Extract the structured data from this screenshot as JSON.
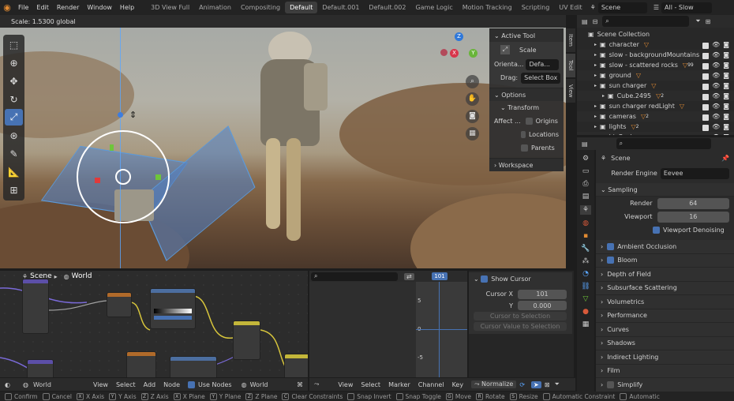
{
  "menu": [
    "File",
    "Edit",
    "Render",
    "Window",
    "Help"
  ],
  "workspaces": [
    "3D View Full",
    "Animation",
    "Compositing",
    "Default",
    "Default.001",
    "Default.002",
    "Game Logic",
    "Motion Tracking",
    "Scripting",
    "UV Edit"
  ],
  "active_workspace": "Default",
  "scene_label": "Scene",
  "view_layer": "All - Slow",
  "viewport": {
    "scale_readout": "Scale: 1.5300 global",
    "side_tabs": [
      "Item",
      "Tool",
      "View"
    ],
    "active_tool": {
      "header": "Active Tool",
      "tool_name": "Scale",
      "orientation_label": "Orienta...",
      "orientation_value": "Defa...",
      "drag_label": "Drag:",
      "drag_value": "Select Box"
    },
    "options": {
      "header": "Options",
      "transform_header": "Transform",
      "affect_label": "Affect ...",
      "affect_items": [
        "Origins",
        "Locations",
        "Parents"
      ]
    },
    "workspace_header": "Workspace",
    "gizmo_axes": [
      "Z",
      "Y",
      "X"
    ]
  },
  "outliner": {
    "search_placeholder": "",
    "root": "Scene Collection",
    "items": [
      {
        "name": "character",
        "badge": ""
      },
      {
        "name": "slow - backgroundMountains",
        "badge": ""
      },
      {
        "name": "slow - scattered rocks",
        "badge": "99"
      },
      {
        "name": "ground",
        "badge": ""
      },
      {
        "name": "sun charger",
        "badge": ""
      },
      {
        "name": "Cube.2495",
        "badge": "2"
      },
      {
        "name": "sun charger redLight",
        "badge": ""
      },
      {
        "name": "cameras",
        "badge": "2"
      },
      {
        "name": "lights",
        "badge": "2"
      },
      {
        "name": "bigRocks",
        "badge": ""
      }
    ]
  },
  "properties": {
    "header": "Scene",
    "render_engine_label": "Render Engine",
    "render_engine_value": "Eevee",
    "sampling_label": "Sampling",
    "render_label": "Render",
    "render_value": "64",
    "viewport_label": "Viewport",
    "viewport_value": "16",
    "denoise_label": "Viewport Denoising",
    "panels": [
      "Ambient Occlusion",
      "Bloom",
      "Depth of Field",
      "Subsurface Scattering",
      "Volumetrics",
      "Performance",
      "Curves",
      "Shadows",
      "Indirect Lighting",
      "Film",
      "Simplify"
    ]
  },
  "node_editor": {
    "header_scene": "Scene",
    "header_world": "World",
    "footer": {
      "world": "World",
      "use_nodes": "Use Nodes",
      "world2": "World"
    }
  },
  "timeline": {
    "current_frame": "101",
    "yticks": [
      "5",
      "0",
      "-5"
    ],
    "menus": [
      "View",
      "Select",
      "Marker",
      "Channel",
      "Key"
    ],
    "normalize": "Normalize"
  },
  "cursor_panel": {
    "show_cursor": "Show Cursor",
    "cursor_x_label": "Cursor X",
    "cursor_x": "101",
    "y_label": "Y",
    "y_value": "0.000",
    "btn1": "Cursor to Selection",
    "btn2": "Cursor Value to Selection"
  },
  "status": [
    {
      "key": "",
      "label": "Confirm"
    },
    {
      "key": "",
      "label": "Cancel"
    },
    {
      "key": "X",
      "label": "X Axis"
    },
    {
      "key": "Y",
      "label": "Y Axis"
    },
    {
      "key": "Z",
      "label": "Z Axis"
    },
    {
      "key": "X",
      "label": "X Plane"
    },
    {
      "key": "Y",
      "label": "Y Plane"
    },
    {
      "key": "Z",
      "label": "Z Plane"
    },
    {
      "key": "C",
      "label": "Clear Constraints"
    },
    {
      "key": "",
      "label": "Snap Invert"
    },
    {
      "key": "",
      "label": "Snap Toggle"
    },
    {
      "key": "G",
      "label": "Move"
    },
    {
      "key": "R",
      "label": "Rotate"
    },
    {
      "key": "S",
      "label": "Resize"
    },
    {
      "key": "",
      "label": "Automatic Constraint"
    },
    {
      "key": "",
      "label": "Automatic"
    }
  ],
  "colors": {
    "accent": "#4772b3",
    "orange": "#e08a32",
    "panel": "#303030"
  }
}
